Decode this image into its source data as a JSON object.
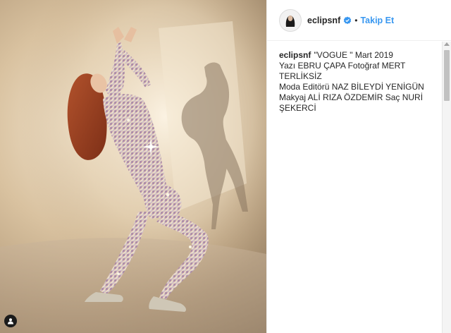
{
  "post": {
    "username": "eclipsnf",
    "separator": "•",
    "follow_label": "Takip Et",
    "caption": "\"VOGUE \" Mart 2019\nYazı EBRU ÇAPA Fotoğraf MERT TERLİKSİZ\nModa Editörü NAZ BİLEYDİ YENİGÜN\nMakyaj ALİ RIZA ÖZDEMİR Saç NURİ\nŞEKERCİ"
  },
  "icons": {
    "verified": "verified-badge-icon",
    "tag": "person-tag-icon",
    "scroll_up": "scroll-up-arrow-icon"
  },
  "colors": {
    "accent": "#3897f0",
    "text": "#262626",
    "border": "#efefef"
  }
}
